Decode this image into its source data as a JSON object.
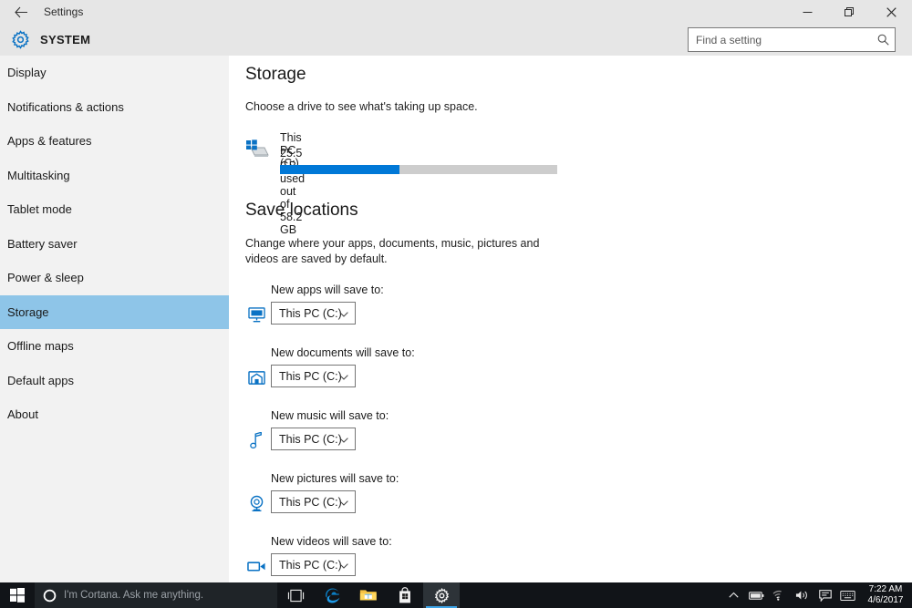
{
  "window": {
    "titlebar_title": "Settings",
    "back_icon": "back-arrow-icon",
    "minimize_label": "─",
    "maximize_label": "❐",
    "close_label": "✕"
  },
  "header": {
    "title": "SYSTEM",
    "gear_icon": "gear-icon"
  },
  "search": {
    "placeholder": "Find a setting",
    "value": "",
    "icon": "search-icon"
  },
  "sidebar": {
    "items": [
      {
        "label": "Display",
        "selected": false
      },
      {
        "label": "Notifications & actions",
        "selected": false
      },
      {
        "label": "Apps & features",
        "selected": false
      },
      {
        "label": "Multitasking",
        "selected": false
      },
      {
        "label": "Tablet mode",
        "selected": false
      },
      {
        "label": "Battery saver",
        "selected": false
      },
      {
        "label": "Power & sleep",
        "selected": false
      },
      {
        "label": "Storage",
        "selected": true
      },
      {
        "label": "Offline maps",
        "selected": false
      },
      {
        "label": "Default apps",
        "selected": false
      },
      {
        "label": "About",
        "selected": false
      }
    ]
  },
  "main": {
    "storage": {
      "heading": "Storage",
      "description": "Choose a drive to see what's taking up space.",
      "drive": {
        "name": "This PC (C:)",
        "usage_text": "25.5 GB used out of 58.2 GB",
        "used_gb": 25.5,
        "total_gb": 58.2,
        "percent_used": 43,
        "bar_fill_color": "#0078d7",
        "bar_track_color": "#cdcdcd",
        "icon": "hard-drive-icon"
      }
    },
    "save_locations": {
      "heading": "Save locations",
      "description": "Change where your apps, documents, music, pictures and videos are saved by default.",
      "rows": [
        {
          "label": "New apps will save to:",
          "value": "This PC (C:)",
          "icon": "monitor-icon"
        },
        {
          "label": "New documents will save to:",
          "value": "This PC (C:)",
          "icon": "documents-folder-icon"
        },
        {
          "label": "New music will save to:",
          "value": "This PC (C:)",
          "icon": "music-note-icon"
        },
        {
          "label": "New pictures will save to:",
          "value": "This PC (C:)",
          "icon": "camera-icon"
        },
        {
          "label": "New videos will save to:",
          "value": "This PC (C:)",
          "icon": "camcorder-icon"
        }
      ]
    }
  },
  "taskbar": {
    "start_icon": "windows-start-icon",
    "cortana_placeholder": "I'm Cortana. Ask me anything.",
    "cortana_icon": "cortana-circle-icon",
    "pinned": [
      {
        "name": "task-view-icon",
        "active": false
      },
      {
        "name": "edge-browser-icon",
        "active": false
      },
      {
        "name": "file-explorer-icon",
        "active": false
      },
      {
        "name": "microsoft-store-icon",
        "active": false
      },
      {
        "name": "settings-icon",
        "active": true
      }
    ],
    "tray": [
      "show-hidden-icons-chevron",
      "battery-icon",
      "wifi-icon",
      "volume-icon",
      "action-center-icon",
      "touch-keyboard-icon"
    ],
    "clock_time": "7:22 AM",
    "clock_date": "4/6/2017"
  },
  "colors": {
    "accent": "#0078d7",
    "selection": "#8ec5e8",
    "chrome": "#e6e6e6",
    "sidebar": "#f2f2f2",
    "taskbar": "#111418"
  }
}
